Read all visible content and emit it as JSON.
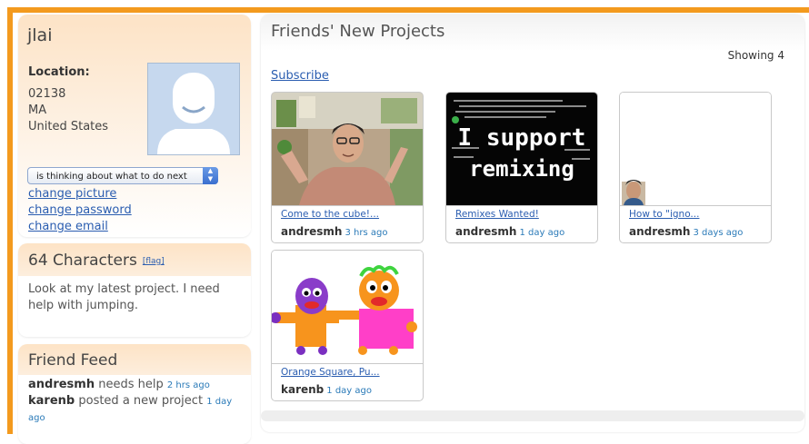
{
  "profile": {
    "username": "jlai",
    "location_label": "Location:",
    "location_lines": [
      "02138",
      "MA",
      "United States"
    ],
    "status_select_value": "is thinking about what to do next",
    "links": [
      "change picture",
      "change password",
      "change email"
    ]
  },
  "characters_panel": {
    "title": "64 Characters",
    "flag_label": "[flag]",
    "body": "Look at my latest project. I need help with jumping."
  },
  "friend_feed": {
    "title": "Friend Feed",
    "items": [
      {
        "user": "andresmh",
        "action": "needs help",
        "time": "2 hrs ago"
      },
      {
        "user": "karenb",
        "action": "posted a new project",
        "time": "1 day ago"
      }
    ]
  },
  "main": {
    "title": "Friends' New Projects",
    "showing": "Showing 4",
    "subscribe": "Subscribe",
    "projects": [
      {
        "title": "Come to the cube!...",
        "user": "andresmh",
        "time": "3 hrs ago"
      },
      {
        "title": "Remixes Wanted!",
        "user": "andresmh",
        "time": "1 day ago",
        "thumb_text_1": "I support",
        "thumb_text_2": "remixing"
      },
      {
        "title": "How to \"igno...",
        "user": "andresmh",
        "time": "3 days ago"
      },
      {
        "title": "Orange Square, Pu...",
        "user": "karenb",
        "time": "1 day ago"
      }
    ]
  },
  "colors": {
    "accent_orange": "#f39a1e",
    "panel_peach": "#fde3c6",
    "link_blue": "#2a5db0",
    "time_blue": "#2a7ab8"
  }
}
